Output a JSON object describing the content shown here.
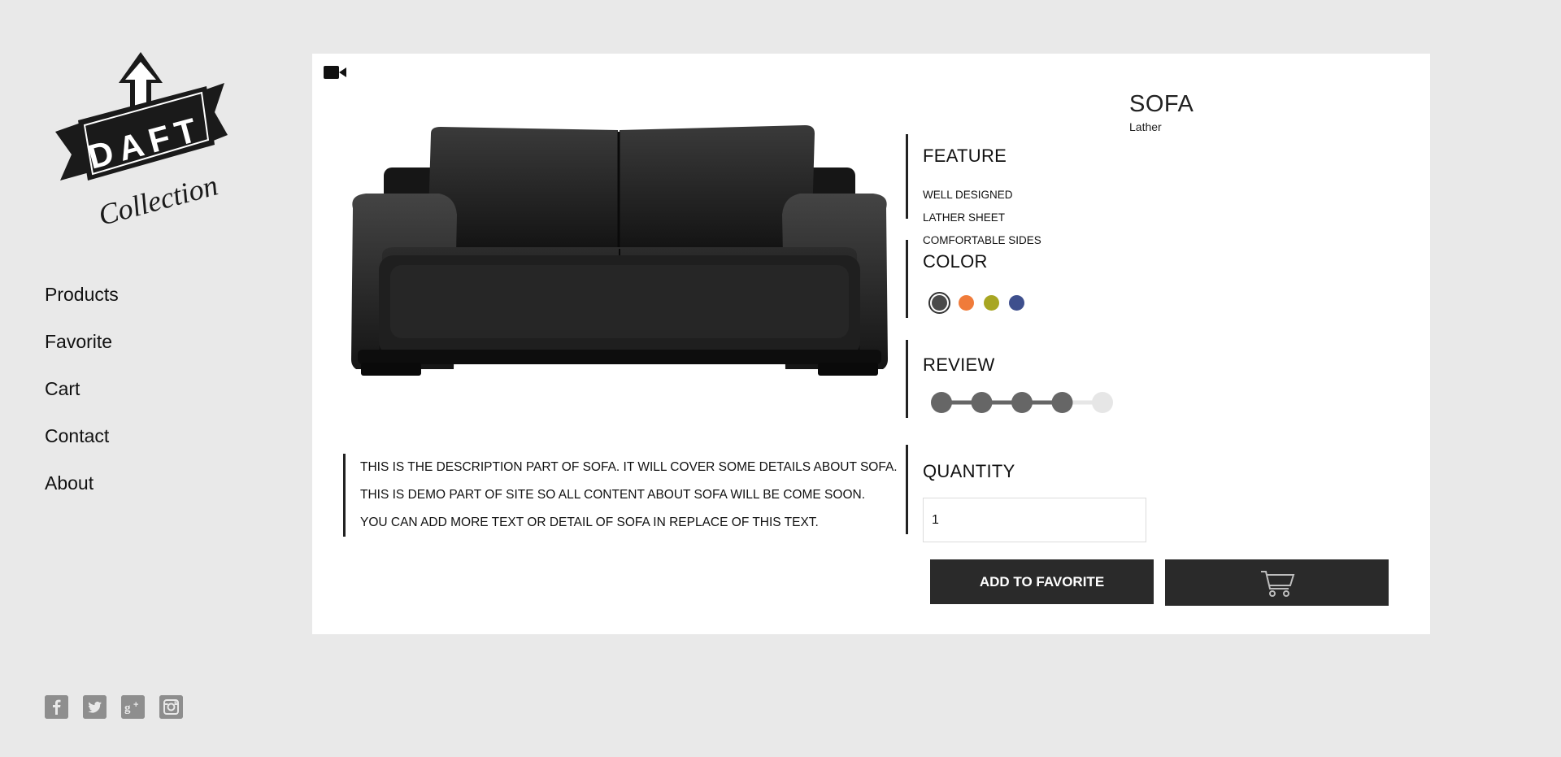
{
  "brand": {
    "logo_top": "DAFT",
    "logo_bottom": "Collection"
  },
  "nav": {
    "items": [
      {
        "label": "Products"
      },
      {
        "label": "Favorite"
      },
      {
        "label": "Cart"
      },
      {
        "label": "Contact"
      },
      {
        "label": "About"
      }
    ]
  },
  "social": {
    "icons": [
      "facebook-icon",
      "twitter-icon",
      "google-plus-icon",
      "instagram-icon"
    ],
    "glyphs": [
      "f",
      "t",
      "g+",
      "ig"
    ]
  },
  "product": {
    "title": "SOFA",
    "subtitle": "Lather",
    "feature_heading": "FEATURE",
    "features": [
      "WELL DESIGNED",
      "LATHER SHEET",
      "COMFORTABLE SIDES"
    ],
    "color_heading": "COLOR",
    "colors": [
      "#4a4a4a",
      "#f07b3a",
      "#a8a622",
      "#3e4f8d"
    ],
    "selected_color_index": 0,
    "review_heading": "REVIEW",
    "rating": 4,
    "rating_max": 5,
    "description": [
      "THIS IS THE DESCRIPTION PART OF SOFA. IT WILL COVER SOME DETAILS ABOUT SOFA.",
      "THIS IS DEMO PART OF SITE SO ALL CONTENT ABOUT SOFA WILL BE COME SOON.",
      "YOU CAN ADD MORE TEXT OR DETAIL OF SOFA IN REPLACE OF THIS TEXT."
    ],
    "quantity_heading": "QUANTITY",
    "quantity_value": "1",
    "favorite_button": "ADD TO FAVORITE",
    "cart_icon": "cart-icon",
    "video_icon": "video-camera-icon"
  },
  "colors": {
    "page_bg": "#e9e9e9",
    "card_bg": "#ffffff",
    "button_bg": "#2a2a2a",
    "rating_active": "#666666",
    "rating_inactive": "#e6e6e6"
  }
}
